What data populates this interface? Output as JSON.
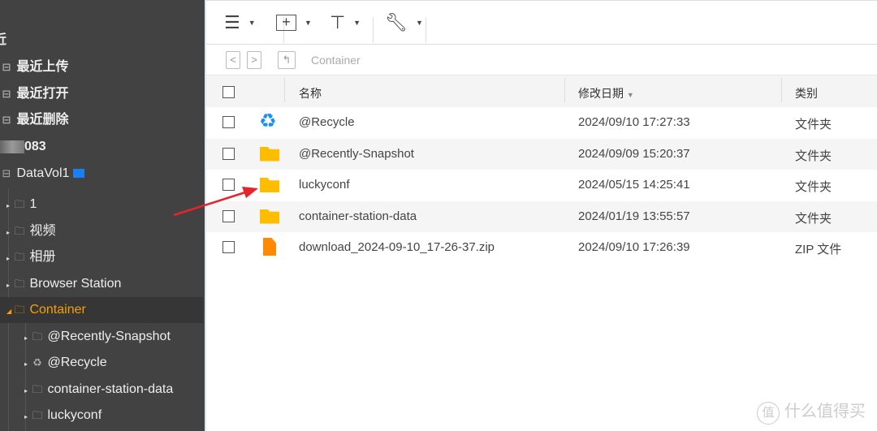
{
  "sidebar": {
    "items": [
      {
        "label": "近",
        "icon": ""
      },
      {
        "label": "最近上传",
        "icon": "list-icon"
      },
      {
        "label": "最近打开",
        "icon": "list-icon"
      },
      {
        "label": "最近删除",
        "icon": "list-icon"
      },
      {
        "label": "083",
        "icon": ""
      },
      {
        "label": "DataVol1",
        "icon": "drive-icon"
      },
      {
        "label": "1",
        "icon": "folder-icon"
      },
      {
        "label": "视频",
        "icon": "folder-icon"
      },
      {
        "label": "相册",
        "icon": "folder-icon"
      },
      {
        "label": "Browser Station",
        "icon": "folder-icon"
      },
      {
        "label": "Container",
        "icon": "folder-icon"
      },
      {
        "label": "@Recently-Snapshot",
        "icon": "folder-icon"
      },
      {
        "label": "@Recycle",
        "icon": "recycle-icon"
      },
      {
        "label": "container-station-data",
        "icon": "folder-icon"
      },
      {
        "label": "luckyconf",
        "icon": "folder-icon"
      }
    ]
  },
  "breadcrumb": "Container",
  "table": {
    "headers": {
      "name": "名称",
      "date": "修改日期",
      "type": "类别"
    },
    "rows": [
      {
        "name": "@Recycle",
        "date": "2024/09/10 17:27:33",
        "type": "文件夹",
        "icon": "recycle-icon"
      },
      {
        "name": "@Recently-Snapshot",
        "date": "2024/09/09 15:20:37",
        "type": "文件夹",
        "icon": "folder-icon"
      },
      {
        "name": "luckyconf",
        "date": "2024/05/15 14:25:41",
        "type": "文件夹",
        "icon": "folder-icon"
      },
      {
        "name": "container-station-data",
        "date": "2024/01/19 13:55:57",
        "type": "文件夹",
        "icon": "folder-icon"
      },
      {
        "name": "download_2024-09-10_17-26-37.zip",
        "date": "2024/09/10 17:26:39",
        "type": "ZIP 文件",
        "icon": "zip-icon"
      }
    ]
  },
  "watermark": {
    "badge": "值",
    "text": "什么值得买"
  },
  "colors": {
    "accent": "#ffa500",
    "folder": "#ffbd00",
    "recycle": "#1a8ff0",
    "annotation": "#e8232a"
  }
}
